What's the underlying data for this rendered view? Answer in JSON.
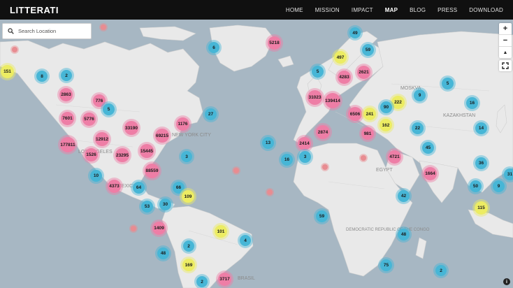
{
  "app": {
    "logo": "LITTERATI"
  },
  "nav": [
    {
      "label": "HOME",
      "active": false
    },
    {
      "label": "MISSION",
      "active": false
    },
    {
      "label": "IMPACT",
      "active": false
    },
    {
      "label": "MAP",
      "active": true
    },
    {
      "label": "BLOG",
      "active": false
    },
    {
      "label": "PRESS",
      "active": false
    },
    {
      "label": "DOWNLOAD",
      "active": false
    }
  ],
  "search": {
    "placeholder": "Search Location"
  },
  "controls": {
    "zoom_in": "+",
    "zoom_out": "−",
    "compass": "▲",
    "info": "i"
  },
  "colors": {
    "pink": "#ee7ea6",
    "blue": "#47b6d6",
    "yellow": "#ecec63",
    "water": "#a7b7c3",
    "land": "#e9e9e9"
  },
  "places": [
    "MOSKVA",
    "NEW YORK CITY",
    "LOS ANGELES",
    "MEXICO",
    "EGYPT",
    "KAZAKHSTAN",
    "DEMOCRATIC REPUBLIC OF THE CONGO",
    "BRASIL"
  ],
  "clusters": [
    {
      "label": "151",
      "color": "yellow"
    },
    {
      "label": "8",
      "color": "blue"
    },
    {
      "label": "2",
      "color": "blue"
    },
    {
      "label": "6",
      "color": "blue"
    },
    {
      "label": "5218",
      "color": "pink"
    },
    {
      "label": "49",
      "color": "blue"
    },
    {
      "label": "497",
      "color": "yellow"
    },
    {
      "label": "59",
      "color": "blue"
    },
    {
      "label": "5",
      "color": "blue"
    },
    {
      "label": "4283",
      "color": "pink"
    },
    {
      "label": "2621",
      "color": "pink"
    },
    {
      "label": "5",
      "color": "blue"
    },
    {
      "label": "2863",
      "color": "pink"
    },
    {
      "label": "776",
      "color": "pink"
    },
    {
      "label": "5",
      "color": "blue"
    },
    {
      "label": "7601",
      "color": "pink"
    },
    {
      "label": "5776",
      "color": "pink"
    },
    {
      "label": "33190",
      "color": "pink"
    },
    {
      "label": "69215",
      "color": "pink"
    },
    {
      "label": "1176",
      "color": "pink"
    },
    {
      "label": "27",
      "color": "blue"
    },
    {
      "label": "12912",
      "color": "pink"
    },
    {
      "label": "177811",
      "color": "pink"
    },
    {
      "label": "1526",
      "color": "pink"
    },
    {
      "label": "23295",
      "color": "pink"
    },
    {
      "label": "15445",
      "color": "pink"
    },
    {
      "label": "3",
      "color": "blue"
    },
    {
      "label": "88559",
      "color": "pink"
    },
    {
      "label": "10",
      "color": "blue"
    },
    {
      "label": "4373",
      "color": "pink"
    },
    {
      "label": "64",
      "color": "blue"
    },
    {
      "label": "66",
      "color": "blue"
    },
    {
      "label": "109",
      "color": "yellow"
    },
    {
      "label": "53",
      "color": "blue"
    },
    {
      "label": "30",
      "color": "blue"
    },
    {
      "label": "31023",
      "color": "pink"
    },
    {
      "label": "139414",
      "color": "pink"
    },
    {
      "label": "222",
      "color": "yellow"
    },
    {
      "label": "9",
      "color": "blue"
    },
    {
      "label": "90",
      "color": "blue"
    },
    {
      "label": "6506",
      "color": "pink"
    },
    {
      "label": "241",
      "color": "yellow"
    },
    {
      "label": "162",
      "color": "yellow"
    },
    {
      "label": "2874",
      "color": "pink"
    },
    {
      "label": "981",
      "color": "pink"
    },
    {
      "label": "16",
      "color": "blue"
    },
    {
      "label": "22",
      "color": "blue"
    },
    {
      "label": "14",
      "color": "blue"
    },
    {
      "label": "13",
      "color": "blue"
    },
    {
      "label": "2414",
      "color": "pink"
    },
    {
      "label": "16",
      "color": "blue"
    },
    {
      "label": "3",
      "color": "blue"
    },
    {
      "label": "45",
      "color": "blue"
    },
    {
      "label": "4721",
      "color": "pink"
    },
    {
      "label": "36",
      "color": "blue"
    },
    {
      "label": "1664",
      "color": "pink"
    },
    {
      "label": "31",
      "color": "blue"
    },
    {
      "label": "50",
      "color": "blue"
    },
    {
      "label": "9",
      "color": "blue"
    },
    {
      "label": "42",
      "color": "blue"
    },
    {
      "label": "115",
      "color": "yellow"
    },
    {
      "label": "59",
      "color": "blue"
    },
    {
      "label": "1409",
      "color": "pink"
    },
    {
      "label": "101",
      "color": "yellow"
    },
    {
      "label": "4",
      "color": "blue"
    },
    {
      "label": "48",
      "color": "blue"
    },
    {
      "label": "2",
      "color": "blue"
    },
    {
      "label": "48",
      "color": "blue"
    },
    {
      "label": "169",
      "color": "yellow"
    },
    {
      "label": "75",
      "color": "blue"
    },
    {
      "label": "2",
      "color": "blue"
    },
    {
      "label": "2",
      "color": "blue"
    },
    {
      "label": "3717",
      "color": "pink"
    }
  ]
}
